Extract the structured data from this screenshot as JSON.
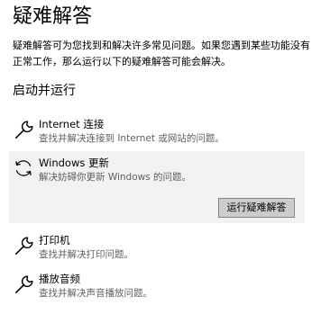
{
  "page": {
    "title": "疑难解答",
    "description": "疑难解答可为您找到和解决许多常见问题。如果您遇到某些功能没有正常工作，那么运行以下的疑难解答可能会解决。"
  },
  "section": {
    "title": "启动并运行"
  },
  "troubleshooters": [
    {
      "name": "Internet 连接",
      "description": "查找并解决连接到 Internet 或网站的问题。",
      "icon": "wrench-icon"
    },
    {
      "name": "Windows 更新",
      "description": "解决妨碍你更新 Windows 的问题。",
      "icon": "refresh-icon",
      "expanded": true,
      "button_label": "运行疑难解答"
    },
    {
      "name": "打印机",
      "description": "查找并解决打印问题。",
      "icon": "wrench-icon"
    },
    {
      "name": "播放音频",
      "description": "查找并解决声音播放问题。",
      "icon": "wrench-icon"
    }
  ],
  "colors": {
    "expanded_background": "#f2f2f2",
    "button_background": "#cccccc",
    "secondary_text": "#5f5f5f"
  }
}
